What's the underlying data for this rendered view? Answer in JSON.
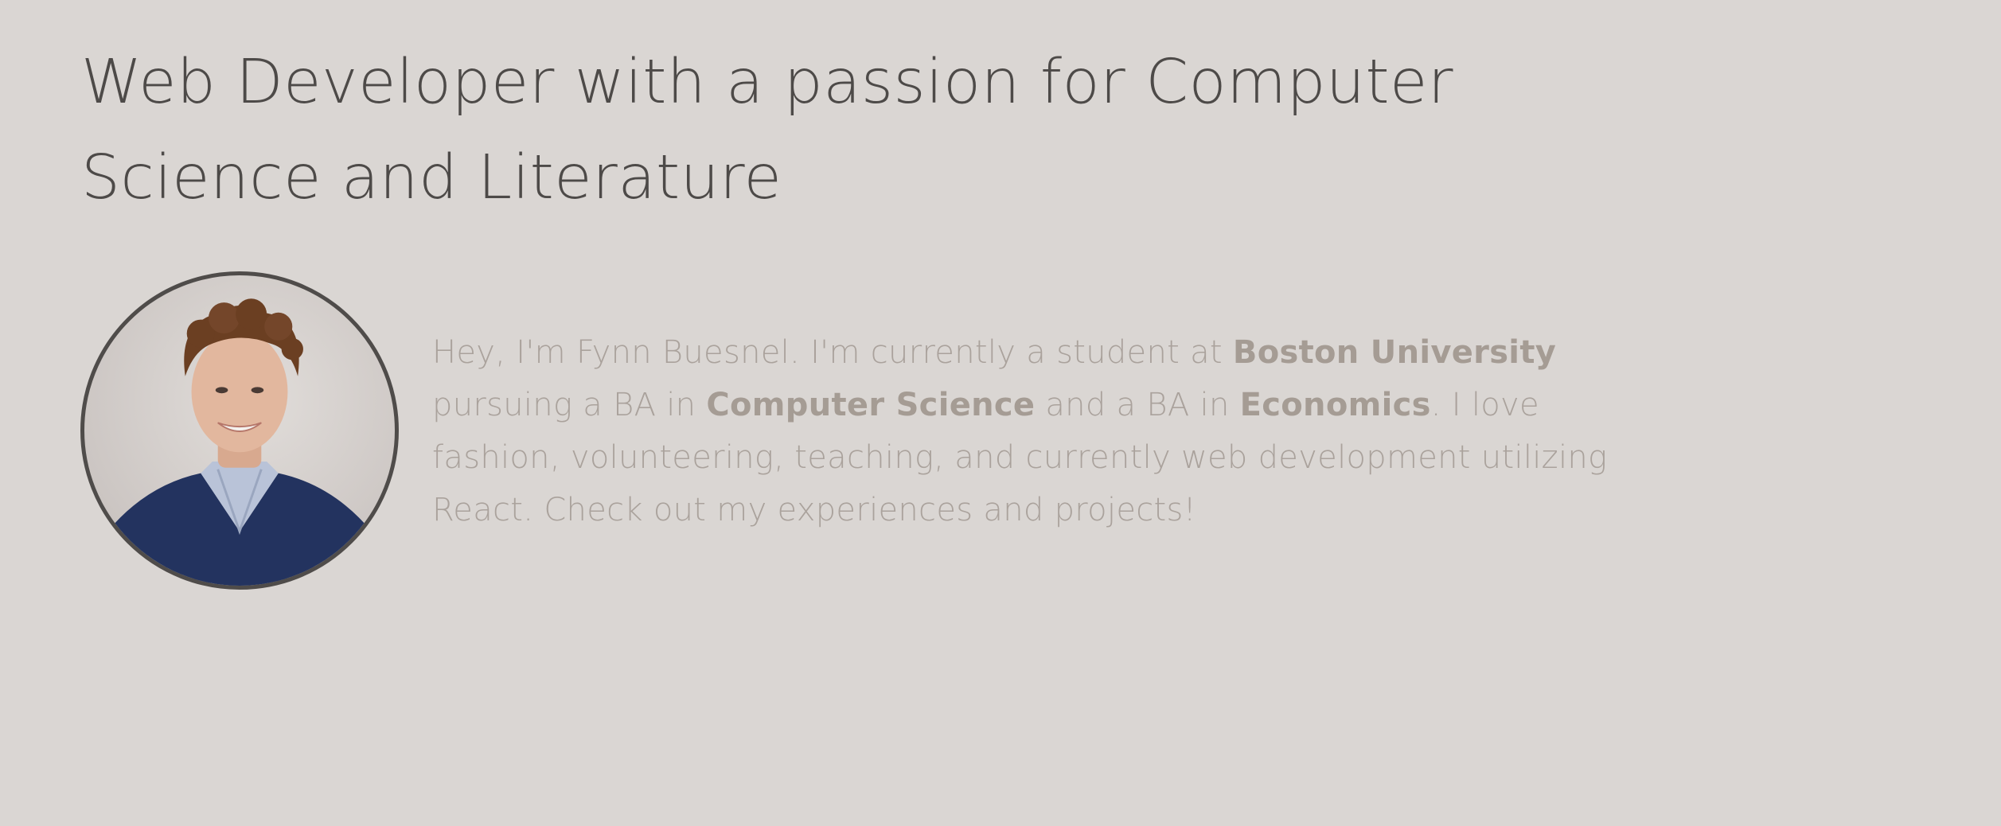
{
  "header": {
    "headline_line1": "Web Developer with a passion for Computer",
    "headline_line2": "Science and Literature"
  },
  "profile": {
    "photo_alt": "Fynn Buesnel"
  },
  "bio": {
    "line1_text": "Hey, I'm Fynn Buesnel. I'm currently a student at ",
    "school": "Boston University",
    "line2_pre": "pursuing a BA in ",
    "major1": "Computer Science",
    "line2_mid": " and a BA in ",
    "major2": "Economics",
    "line2_post": ". I love",
    "line3": "fashion, volunteering, teaching, and currently web development utilizing",
    "line4": "React. Check out my experiences and projects!"
  },
  "colors": {
    "background": "#dad6d3",
    "headline": "#4d4a48",
    "bio_text": "#aaa29c",
    "photo_border": "#4f4c4a"
  }
}
